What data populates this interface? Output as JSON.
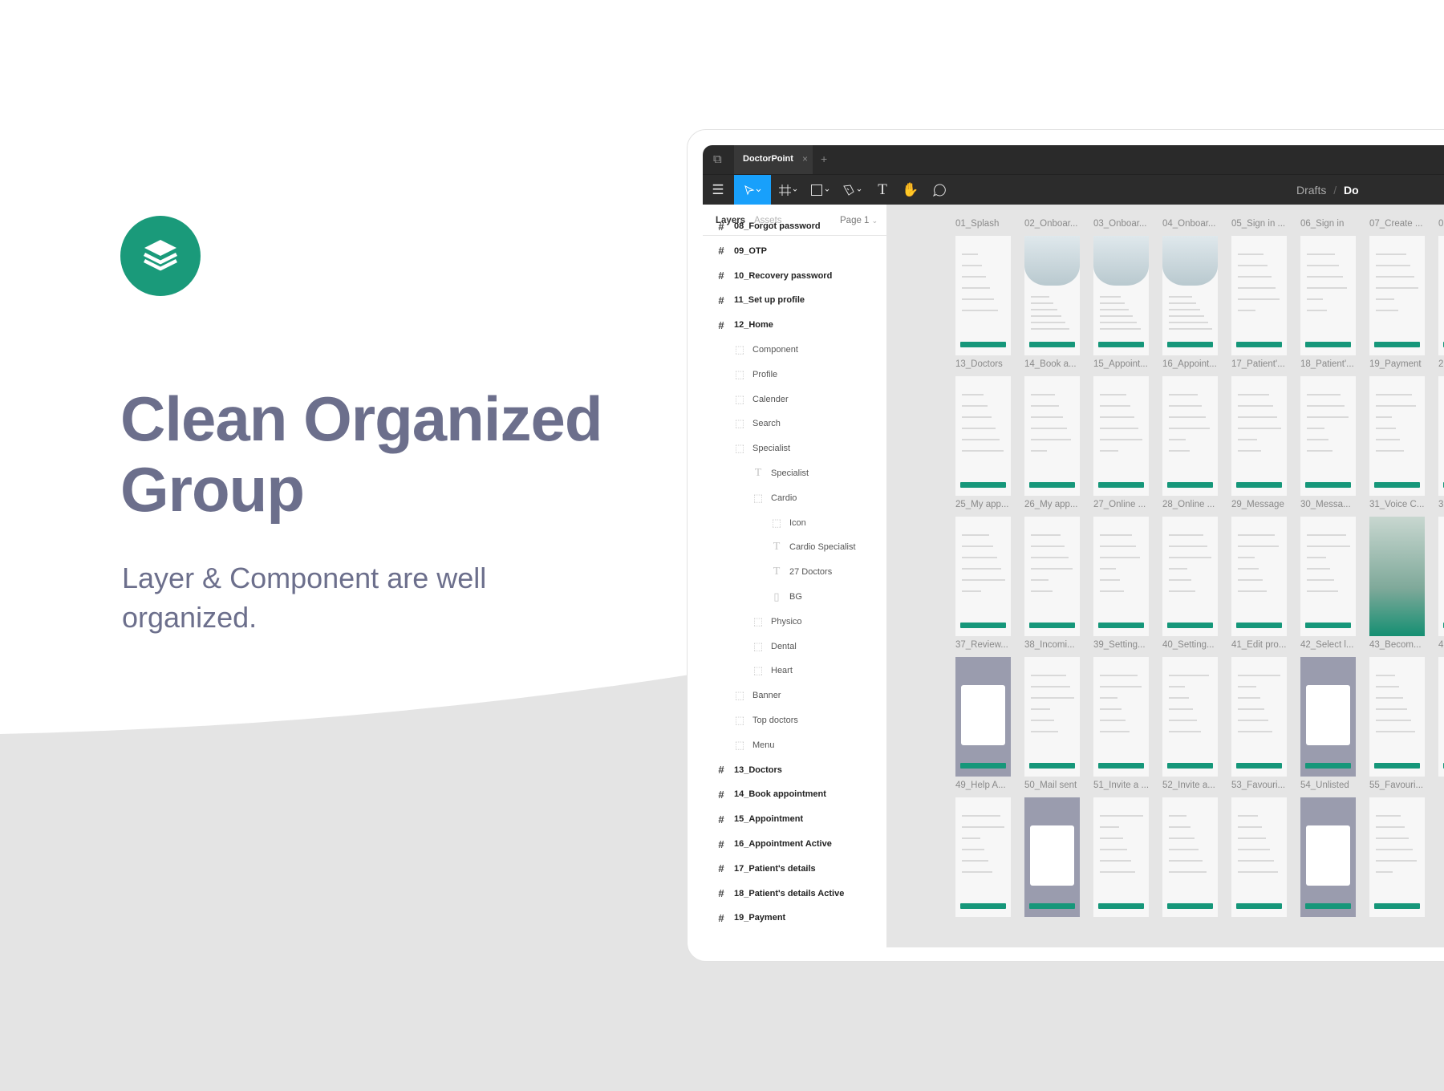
{
  "hero": {
    "title_line1": "Clean Organized",
    "title_line2": "Group",
    "subtitle": "Layer & Component are well organized.",
    "brand_color": "#1a9a7a",
    "logo_icon": "layers-icon"
  },
  "app": {
    "tab_title": "DoctorPoint",
    "breadcrumb": [
      "Drafts",
      "Do"
    ],
    "tools": [
      "menu-icon",
      "move-tool-icon",
      "frame-tool-icon",
      "rectangle-tool-icon",
      "pen-tool-icon",
      "text-tool-icon",
      "hand-tool-icon",
      "comment-tool-icon"
    ],
    "active_tool": "move",
    "accent_color": "#18a0fb"
  },
  "layers_panel": {
    "tab_layers": "Layers",
    "tab_assets": "Assets",
    "page": "Page 1",
    "items": [
      {
        "label": "08_Forgot password",
        "type": "frame",
        "level": 0
      },
      {
        "label": "09_OTP",
        "type": "frame",
        "level": 0
      },
      {
        "label": "10_Recovery password",
        "type": "frame",
        "level": 0
      },
      {
        "label": "11_Set up profile",
        "type": "frame",
        "level": 0
      },
      {
        "label": "12_Home",
        "type": "frame",
        "level": 0
      },
      {
        "label": "Component",
        "type": "group",
        "level": 1
      },
      {
        "label": "Profile",
        "type": "group",
        "level": 1
      },
      {
        "label": "Calender",
        "type": "group",
        "level": 1
      },
      {
        "label": "Search",
        "type": "group",
        "level": 1
      },
      {
        "label": "Specialist",
        "type": "group",
        "level": 1
      },
      {
        "label": "Specialist",
        "type": "text",
        "level": 2
      },
      {
        "label": "Cardio",
        "type": "group",
        "level": 2
      },
      {
        "label": "Icon",
        "type": "group",
        "level": 3
      },
      {
        "label": "Cardio Specialist",
        "type": "text",
        "level": 3
      },
      {
        "label": "27 Doctors",
        "type": "text",
        "level": 3
      },
      {
        "label": "BG",
        "type": "rect",
        "level": 3
      },
      {
        "label": "Physico",
        "type": "group",
        "level": 2
      },
      {
        "label": "Dental",
        "type": "group",
        "level": 2
      },
      {
        "label": "Heart",
        "type": "group",
        "level": 2
      },
      {
        "label": "Banner",
        "type": "group",
        "level": 1
      },
      {
        "label": "Top doctors",
        "type": "group",
        "level": 1
      },
      {
        "label": "Menu",
        "type": "group",
        "level": 1
      },
      {
        "label": "13_Doctors",
        "type": "frame",
        "level": 0
      },
      {
        "label": "14_Book appointment",
        "type": "frame",
        "level": 0
      },
      {
        "label": "15_Appointment",
        "type": "frame",
        "level": 0
      },
      {
        "label": "16_Appointment Active",
        "type": "frame",
        "level": 0
      },
      {
        "label": "17_Patient's details",
        "type": "frame",
        "level": 0
      },
      {
        "label": "18_Patient's details Active",
        "type": "frame",
        "level": 0
      },
      {
        "label": "19_Payment",
        "type": "frame",
        "level": 0
      }
    ]
  },
  "canvas": {
    "rows": [
      [
        {
          "label": "01_Splash",
          "theme": "light"
        },
        {
          "label": "02_Onboar...",
          "theme": "hero"
        },
        {
          "label": "03_Onboar...",
          "theme": "hero"
        },
        {
          "label": "04_Onboar...",
          "theme": "hero"
        },
        {
          "label": "05_Sign in ...",
          "theme": "light"
        },
        {
          "label": "06_Sign in",
          "theme": "light"
        },
        {
          "label": "07_Create ...",
          "theme": "light"
        },
        {
          "label": "0",
          "theme": "light"
        }
      ],
      [
        {
          "label": "13_Doctors",
          "theme": "light"
        },
        {
          "label": "14_Book a...",
          "theme": "light"
        },
        {
          "label": "15_Appoint...",
          "theme": "light"
        },
        {
          "label": "16_Appoint...",
          "theme": "light"
        },
        {
          "label": "17_Patient'...",
          "theme": "light"
        },
        {
          "label": "18_Patient'...",
          "theme": "light"
        },
        {
          "label": "19_Payment",
          "theme": "light"
        },
        {
          "label": "2",
          "theme": "light"
        }
      ],
      [
        {
          "label": "25_My app...",
          "theme": "light"
        },
        {
          "label": "26_My app...",
          "theme": "light"
        },
        {
          "label": "27_Online ...",
          "theme": "light"
        },
        {
          "label": "28_Online ...",
          "theme": "light"
        },
        {
          "label": "29_Message",
          "theme": "light"
        },
        {
          "label": "30_Messa...",
          "theme": "light"
        },
        {
          "label": "31_Voice C...",
          "theme": "photo"
        },
        {
          "label": "3",
          "theme": "light"
        }
      ],
      [
        {
          "label": "37_Review...",
          "theme": "overlay"
        },
        {
          "label": "38_Incomi...",
          "theme": "light"
        },
        {
          "label": "39_Setting...",
          "theme": "light"
        },
        {
          "label": "40_Setting...",
          "theme": "light"
        },
        {
          "label": "41_Edit pro...",
          "theme": "light"
        },
        {
          "label": "42_Select l...",
          "theme": "overlay"
        },
        {
          "label": "43_Becom...",
          "theme": "light"
        },
        {
          "label": "4",
          "theme": "light"
        }
      ],
      [
        {
          "label": "49_Help A...",
          "theme": "light"
        },
        {
          "label": "50_Mail sent",
          "theme": "overlay"
        },
        {
          "label": "51_Invite a ...",
          "theme": "light"
        },
        {
          "label": "52_Invite a...",
          "theme": "light"
        },
        {
          "label": "53_Favouri...",
          "theme": "light"
        },
        {
          "label": "54_Unlisted",
          "theme": "overlay"
        },
        {
          "label": "55_Favouri...",
          "theme": "light"
        }
      ]
    ]
  }
}
